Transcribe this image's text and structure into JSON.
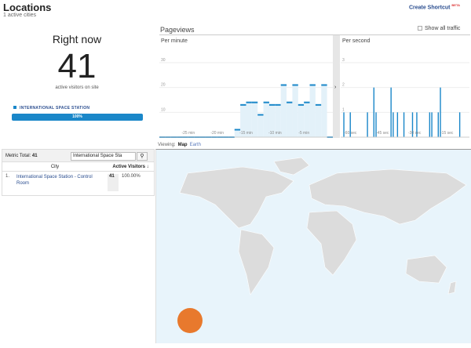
{
  "header": {
    "title": "Locations",
    "subtitle": "1 active cities",
    "shortcut": "Create Shortcut",
    "beta": "BETA"
  },
  "rightnow": {
    "label": "Right now",
    "count": "41",
    "caption": "active visitors on site",
    "location": "INTERNATIONAL SPACE STATION",
    "bar_label": "100%",
    "bar_percent": 100,
    "color": "#1a87c9"
  },
  "pageviews": {
    "title": "Pageviews",
    "show_all": "Show all traffic",
    "show_all_checked": false
  },
  "chart_data": [
    {
      "type": "bar",
      "title": "Per minute",
      "ylim": [
        0,
        30
      ],
      "yticks": [
        "10",
        "20",
        "30"
      ],
      "xticks": [
        "-25 min",
        "-20 min",
        "-15 min",
        "-10 min",
        "-5 min"
      ],
      "values": [
        0,
        0,
        0,
        0,
        0,
        0,
        0,
        0,
        0,
        0,
        0,
        0,
        0,
        3,
        13,
        14,
        14,
        9,
        14,
        13,
        13,
        21,
        14,
        21,
        13,
        14,
        21,
        13,
        21,
        0
      ]
    },
    {
      "type": "bar",
      "title": "Per second",
      "ylim": [
        0,
        3
      ],
      "yticks": [
        "1",
        "2",
        "3"
      ],
      "xticks": [
        "-60 sec",
        "-45 sec",
        "-30 sec",
        "-15 sec"
      ],
      "values": [
        0,
        1,
        0,
        0,
        1,
        0,
        0,
        0,
        0,
        0,
        0,
        0,
        1,
        0,
        0,
        2,
        1,
        0,
        0,
        0,
        0,
        0,
        0,
        2,
        1,
        0,
        1,
        0,
        0,
        1,
        0,
        0,
        0,
        1,
        0,
        1,
        0,
        0,
        0,
        0,
        0,
        1,
        1,
        0,
        0,
        1,
        2,
        0,
        0,
        0,
        0,
        0,
        0,
        0,
        0,
        1,
        0,
        0,
        0,
        0
      ]
    }
  ],
  "viewing": {
    "label": "Viewing:",
    "map": "Map",
    "earth": "Earth"
  },
  "table": {
    "metric_label": "Metric Total:",
    "metric_total": "41",
    "search_value": "International Space Sta",
    "headers": [
      "City",
      "Active Visitors"
    ],
    "rows": [
      {
        "idx": "1.",
        "city": "International Space Station - Control Room",
        "visitors": "41",
        "pct": "100.00%"
      }
    ]
  },
  "map": {
    "marker_color": "#e8792d",
    "land_color": "#dcdcdc",
    "water_color": "#e8f4fb"
  }
}
